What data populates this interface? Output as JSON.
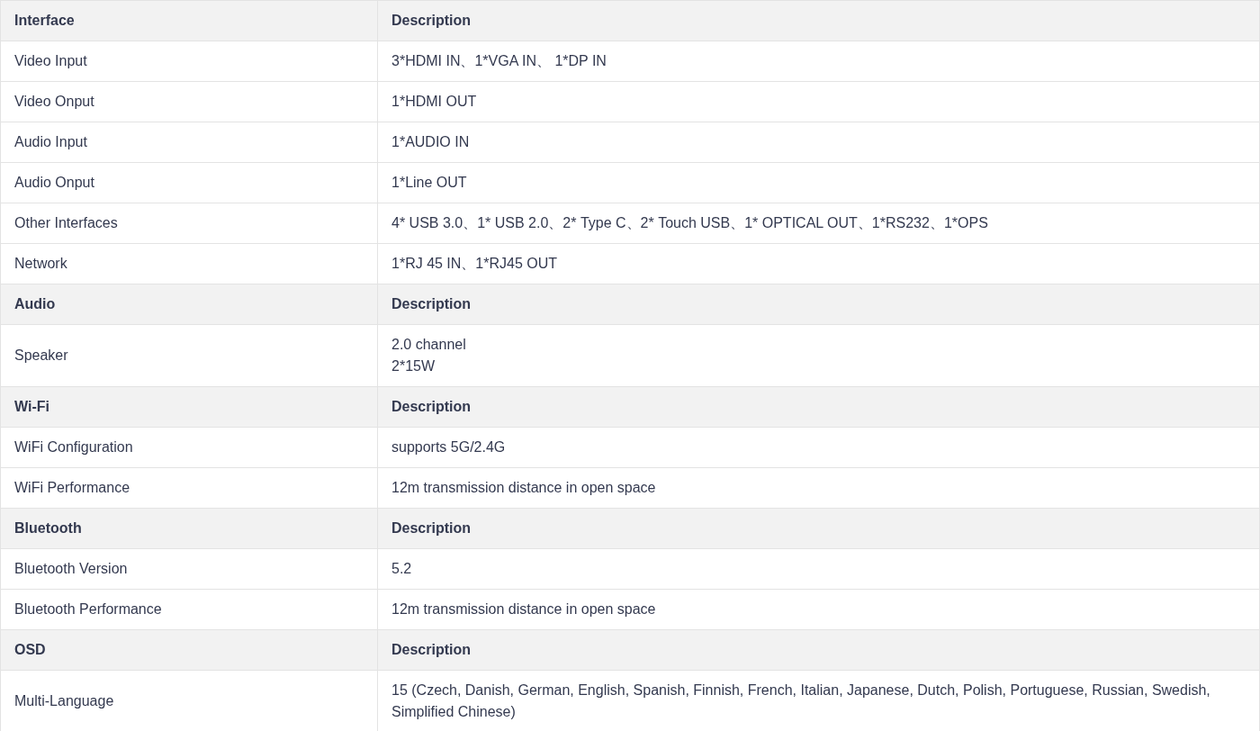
{
  "table": {
    "rows": [
      {
        "kind": "header",
        "cells": [
          [
            "Interface"
          ],
          [
            "Description"
          ]
        ]
      },
      {
        "kind": "data",
        "cells": [
          [
            "Video Input"
          ],
          [
            "3*HDMI IN、1*VGA IN、 1*DP IN"
          ]
        ]
      },
      {
        "kind": "data",
        "cells": [
          [
            "Video Onput"
          ],
          [
            "1*HDMI OUT"
          ]
        ]
      },
      {
        "kind": "data",
        "cells": [
          [
            "Audio Input"
          ],
          [
            "1*AUDIO IN"
          ]
        ]
      },
      {
        "kind": "data",
        "cells": [
          [
            "Audio Onput"
          ],
          [
            "1*Line OUT"
          ]
        ]
      },
      {
        "kind": "data",
        "cells": [
          [
            "Other Interfaces"
          ],
          [
            "4* USB 3.0、1* USB 2.0、2* Type C、2* Touch USB、1* OPTICAL OUT、1*RS232、1*OPS"
          ]
        ]
      },
      {
        "kind": "data",
        "cells": [
          [
            "Network"
          ],
          [
            "1*RJ 45 IN、1*RJ45 OUT"
          ]
        ]
      },
      {
        "kind": "header",
        "cells": [
          [
            "Audio"
          ],
          [
            "Description"
          ]
        ]
      },
      {
        "kind": "data",
        "cells": [
          [
            "Speaker"
          ],
          [
            "2.0 channel",
            "2*15W"
          ]
        ]
      },
      {
        "kind": "header",
        "cells": [
          [
            "Wi-Fi"
          ],
          [
            "Description"
          ]
        ]
      },
      {
        "kind": "data",
        "cells": [
          [
            "WiFi Configuration"
          ],
          [
            "supports 5G/2.4G"
          ]
        ]
      },
      {
        "kind": "data",
        "cells": [
          [
            "WiFi Performance"
          ],
          [
            "12m transmission distance in open space"
          ]
        ]
      },
      {
        "kind": "header",
        "cells": [
          [
            "Bluetooth"
          ],
          [
            "Description"
          ]
        ]
      },
      {
        "kind": "data",
        "cells": [
          [
            "Bluetooth Version"
          ],
          [
            "5.2"
          ]
        ]
      },
      {
        "kind": "data",
        "cells": [
          [
            "Bluetooth Performance"
          ],
          [
            "12m transmission distance in open space"
          ]
        ]
      },
      {
        "kind": "header",
        "cells": [
          [
            "OSD"
          ],
          [
            "Description"
          ]
        ]
      },
      {
        "kind": "data",
        "cells": [
          [
            "Multi-Language"
          ],
          [
            "15 (Czech, Danish, German, English, Spanish, Finnish, French, Italian, Japanese, Dutch, Polish, Portuguese, Russian, Swedish, Simplified Chinese)"
          ]
        ]
      }
    ]
  }
}
